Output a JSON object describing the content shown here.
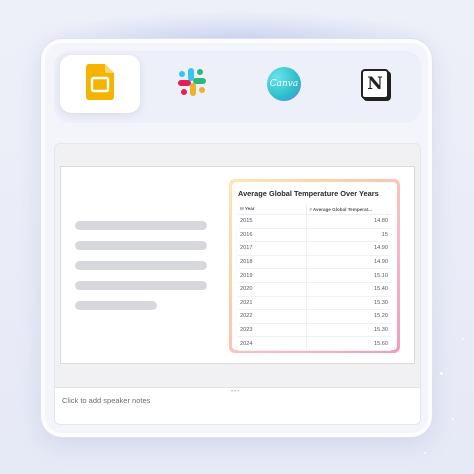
{
  "apps": [
    {
      "name": "Google Slides",
      "icon": "google-slides-icon",
      "active": true
    },
    {
      "name": "Slack",
      "icon": "slack-icon",
      "active": false
    },
    {
      "name": "Canva",
      "icon": "canva-icon",
      "active": false,
      "logo_text": "Canva"
    },
    {
      "name": "Notion",
      "icon": "notion-icon",
      "active": false,
      "logo_text": "N"
    }
  ],
  "slide": {
    "table": {
      "title": "Average Global Temperature Over Years",
      "columns": [
        "Year",
        "Average Global Temperat..."
      ],
      "rows": [
        [
          "2015",
          "14.80"
        ],
        [
          "2016",
          "15"
        ],
        [
          "2017",
          "14.90"
        ],
        [
          "2018",
          "14.90"
        ],
        [
          "2019",
          "15.10"
        ],
        [
          "2020",
          "15.40"
        ],
        [
          "2021",
          "15.30"
        ],
        [
          "2022",
          "15.20"
        ],
        [
          "2023",
          "15.30"
        ],
        [
          "2024",
          "15.60"
        ]
      ]
    }
  },
  "notes": {
    "placeholder": "Click to add speaker notes"
  },
  "colors": {
    "slides_yellow": "#F4B400",
    "canva_teal": "#2bbfc9",
    "table_border_gradient": [
      "#fde7b5",
      "#f29bbf"
    ]
  }
}
